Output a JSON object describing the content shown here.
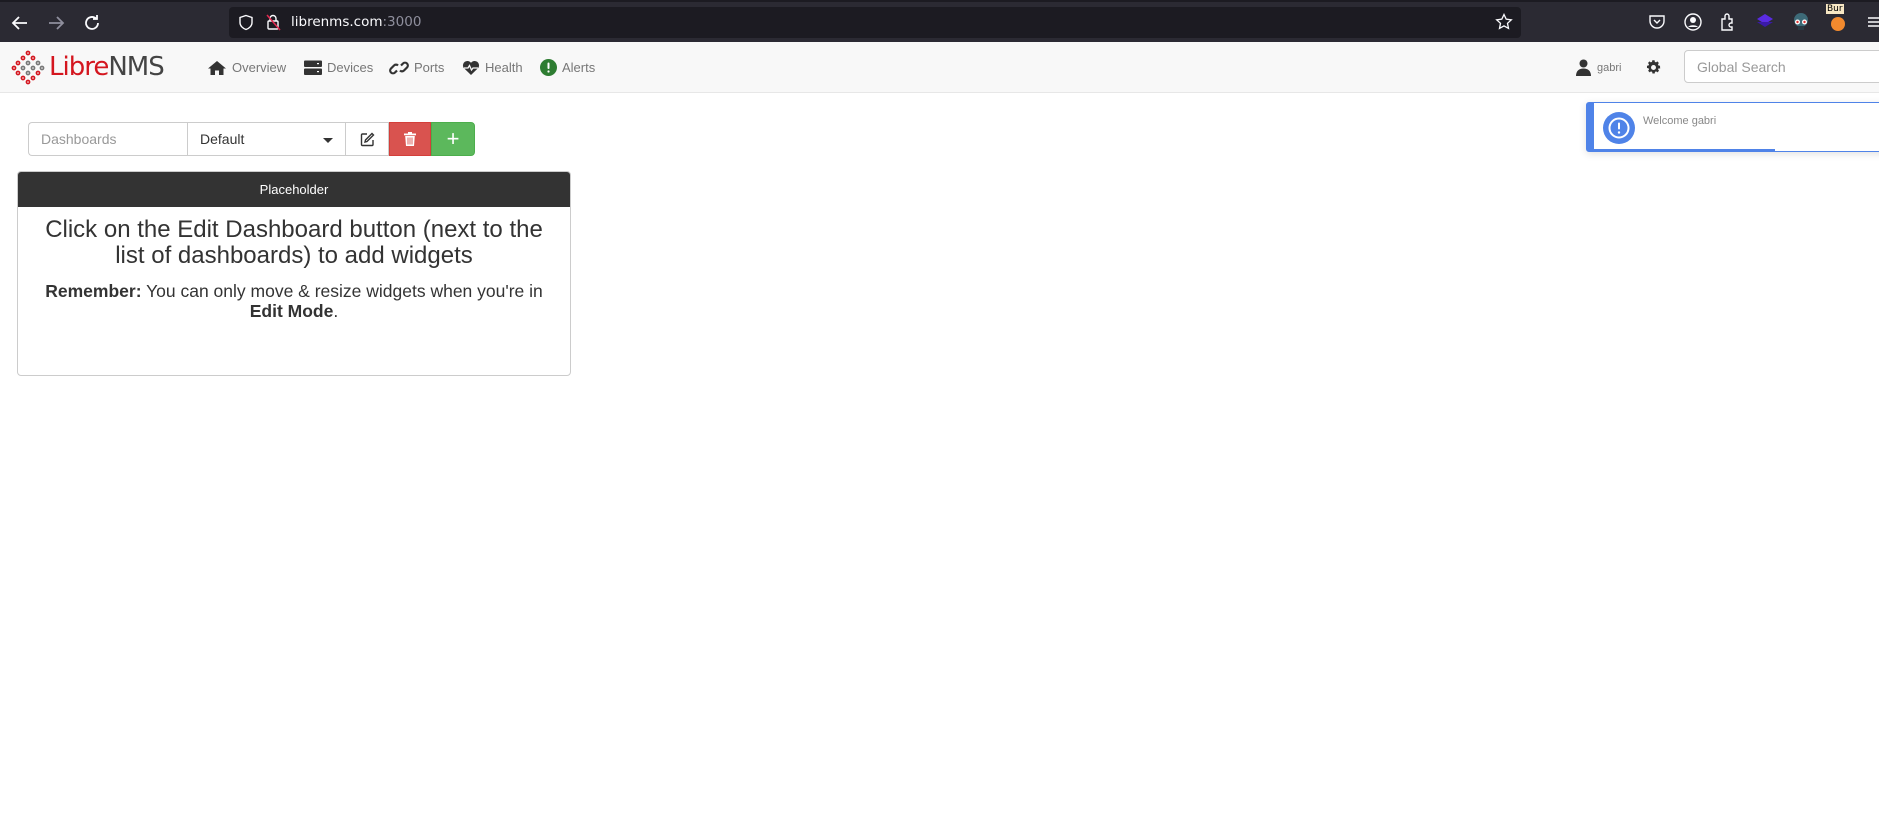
{
  "browser": {
    "url_host": "librenms.com",
    "url_port": ":3000",
    "extension_badge": "Bur"
  },
  "navbar": {
    "brand_part1": "Libre",
    "brand_part2": "NMS",
    "items": [
      {
        "label": "Overview",
        "icon": "home-icon"
      },
      {
        "label": "Devices",
        "icon": "server-icon"
      },
      {
        "label": "Ports",
        "icon": "link-icon"
      },
      {
        "label": "Health",
        "icon": "heartbeat-icon"
      },
      {
        "label": "Alerts",
        "icon": "exclamation-circle-icon"
      }
    ],
    "user": "gabri",
    "search_placeholder": "Global Search"
  },
  "toast": {
    "message": "Welcome gabri",
    "color": "#4f83e8",
    "progress_fraction": 0.6
  },
  "dashboard": {
    "label": "Dashboards",
    "selected": "Default",
    "add_label": "+"
  },
  "widget": {
    "title": "Placeholder",
    "heading": "Click on the Edit Dashboard button (next to the list of dashboards) to add widgets",
    "remember_label": "Remember:",
    "remember_text": " You can only move & resize widgets when you're in ",
    "edit_mode": "Edit Mode",
    "period": "."
  },
  "colors": {
    "brand_red": "#d4161f",
    "delete": "#d9534f",
    "add": "#5cb85c",
    "alerts_green": "#2e7d32",
    "header_dark": "#333333"
  }
}
